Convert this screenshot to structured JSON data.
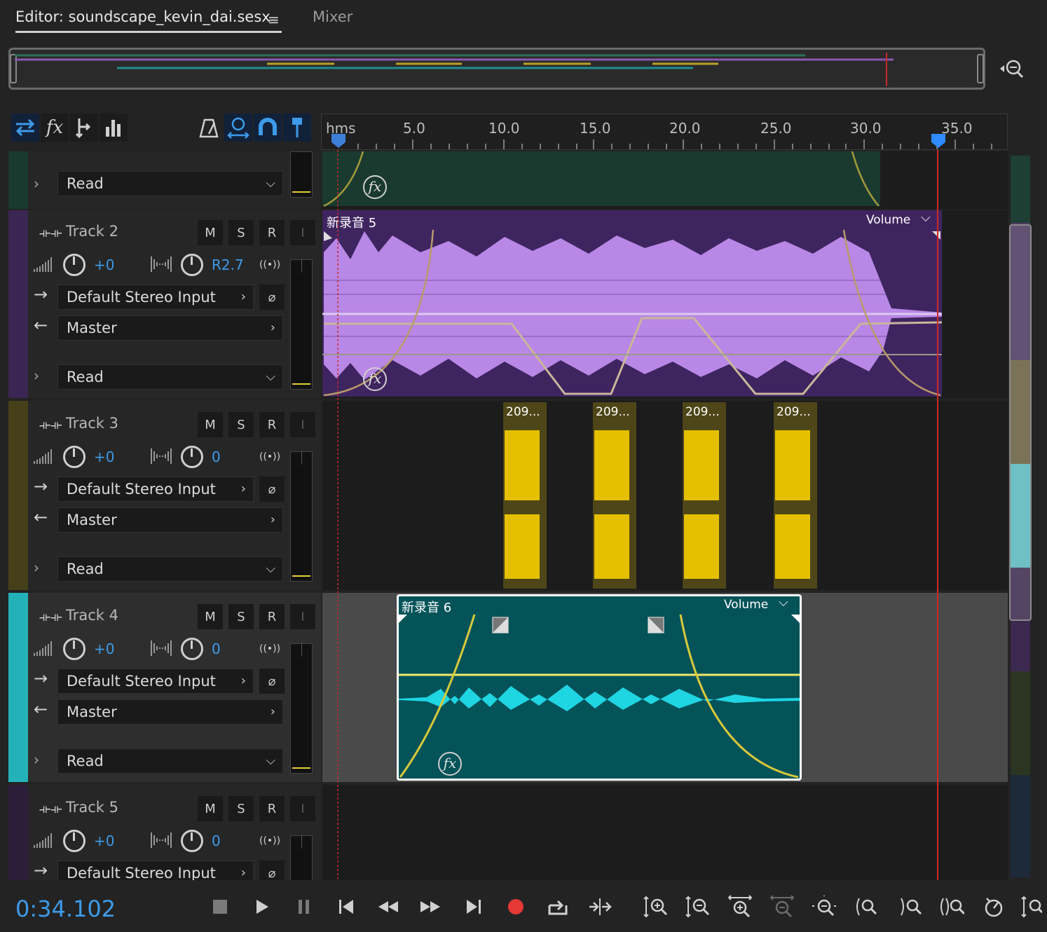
{
  "tabs": {
    "editor_label": "Editor: soundscape_kevin_dai.sesx",
    "menu_icon": "≡",
    "mixer_label": "Mixer"
  },
  "ruler": {
    "labels": [
      "hms",
      "5.0",
      "10.0",
      "15.0",
      "20.0",
      "25.0",
      "30.0",
      "35.0"
    ]
  },
  "track1": {
    "read_mode": "Read"
  },
  "track2": {
    "name": "Track 2",
    "m": "M",
    "s": "S",
    "r": "R",
    "i": "I",
    "volume": "+0",
    "pan": "R2.7",
    "input": "Default Stereo Input",
    "output": "Master",
    "read_mode": "Read",
    "clip_title": "新录音 5",
    "clip_envelope": "Volume",
    "color": "#5a3a78"
  },
  "track3": {
    "name": "Track 3",
    "m": "M",
    "s": "S",
    "r": "R",
    "i": "I",
    "volume": "+0",
    "pan": "0",
    "input": "Default Stereo Input",
    "output": "Master",
    "read_mode": "Read",
    "clips": [
      "209...",
      "209...",
      "209...",
      "209..."
    ],
    "color": "#e5c000"
  },
  "track4": {
    "name": "Track 4",
    "m": "M",
    "s": "S",
    "r": "R",
    "i": "I",
    "volume": "+0",
    "pan": "0",
    "input": "Default Stereo Input",
    "output": "Master",
    "read_mode": "Read",
    "clip_title": "新录音 6",
    "clip_envelope": "Volume",
    "color": "#23b2b8"
  },
  "track5": {
    "name": "Track 5",
    "m": "M",
    "s": "S",
    "r": "R",
    "i": "I",
    "volume": "+0",
    "pan": "0",
    "input": "Default Stereo Input"
  },
  "transport": {
    "time": "0:34.102"
  },
  "icons": {
    "fx": "fx"
  }
}
